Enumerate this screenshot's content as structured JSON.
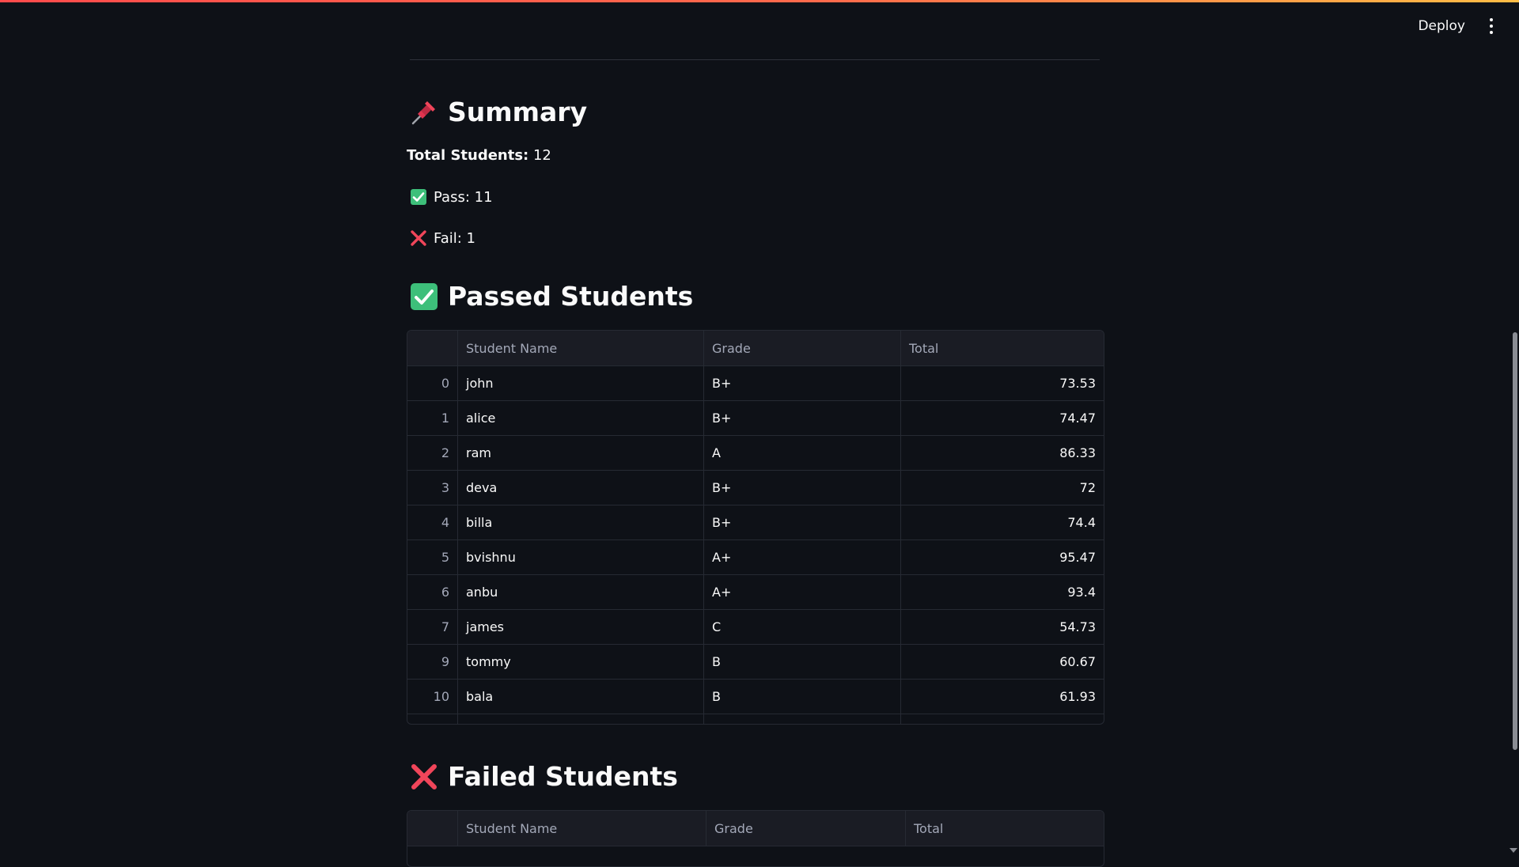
{
  "toolbar": {
    "deploy_label": "Deploy"
  },
  "summary": {
    "title": "Summary",
    "total_label": "Total Students:",
    "total_value": "12",
    "pass_text": "Pass: 11",
    "fail_text": "Fail: 1"
  },
  "passed": {
    "title": "Passed Students",
    "columns": [
      "",
      "Student Name",
      "Grade",
      "Total"
    ],
    "rows": [
      {
        "index": "0",
        "name": "john",
        "grade": "B+",
        "total": "73.53"
      },
      {
        "index": "1",
        "name": "alice",
        "grade": "B+",
        "total": "74.47"
      },
      {
        "index": "2",
        "name": "ram",
        "grade": "A",
        "total": "86.33"
      },
      {
        "index": "3",
        "name": "deva",
        "grade": "B+",
        "total": "72"
      },
      {
        "index": "4",
        "name": "billa",
        "grade": "B+",
        "total": "74.4"
      },
      {
        "index": "5",
        "name": "bvishnu",
        "grade": "A+",
        "total": "95.47"
      },
      {
        "index": "6",
        "name": "anbu",
        "grade": "A+",
        "total": "93.4"
      },
      {
        "index": "7",
        "name": "james",
        "grade": "C",
        "total": "54.73"
      },
      {
        "index": "9",
        "name": "tommy",
        "grade": "B",
        "total": "60.67"
      },
      {
        "index": "10",
        "name": "bala",
        "grade": "B",
        "total": "61.93"
      }
    ]
  },
  "failed": {
    "title": "Failed Students",
    "columns": [
      "",
      "Student Name",
      "Grade",
      "Total"
    ]
  },
  "colors": {
    "background": "#0e1117",
    "accent_start": "#ff4b4b",
    "accent_end": "#ffbd45",
    "check_green": "#3dbf7a",
    "cross_red": "#f0455a",
    "pin_red": "#e0344f"
  },
  "icons": {
    "pin": "pushpin-icon",
    "check": "check-mark-button-icon",
    "cross": "cross-mark-icon",
    "menu": "kebab-menu-icon"
  }
}
